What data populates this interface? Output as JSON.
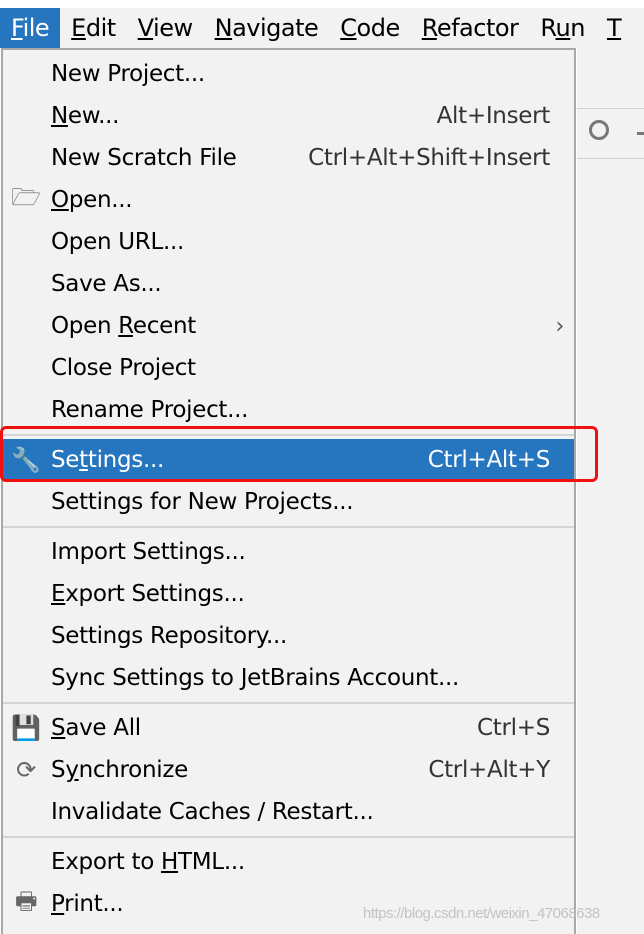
{
  "menubar": [
    {
      "pre": "",
      "m": "F",
      "post": "ile",
      "active": true
    },
    {
      "pre": "",
      "m": "E",
      "post": "dit"
    },
    {
      "pre": "",
      "m": "V",
      "post": "iew"
    },
    {
      "pre": "",
      "m": "N",
      "post": "avigate"
    },
    {
      "pre": "",
      "m": "C",
      "post": "ode"
    },
    {
      "pre": "",
      "m": "R",
      "post": "efactor"
    },
    {
      "pre": "R",
      "m": "u",
      "post": "n"
    },
    {
      "pre": "",
      "m": "T",
      "post": ""
    }
  ],
  "menu": [
    {
      "pre": "New Project...",
      "m": "",
      "post": "",
      "y": 0
    },
    {
      "pre": "",
      "m": "N",
      "post": "ew...",
      "shortcut": "Alt+Insert"
    },
    {
      "pre": "New Scratch File",
      "m": "",
      "post": "",
      "shortcut": "Ctrl+Alt+Shift+Insert"
    },
    {
      "pre": "",
      "m": "O",
      "post": "pen...",
      "icon": "folder-open-icon"
    },
    {
      "pre": "Open URL...",
      "m": "",
      "post": ""
    },
    {
      "pre": "Save As...",
      "m": "",
      "post": ""
    },
    {
      "pre": "Open ",
      "m": "R",
      "post": "ecent",
      "submenu": true
    },
    {
      "pre": "Close Pro",
      "m": "j",
      "post": "ect"
    },
    {
      "pre": "Rename Project...",
      "m": "",
      "post": "",
      "sepAfter": true
    },
    {
      "pre": "Se",
      "m": "t",
      "post": "tings...",
      "shortcut": "Ctrl+Alt+S",
      "icon": "wrench-icon",
      "selected": true
    },
    {
      "pre": "Settings for New Projects...",
      "m": "",
      "post": "",
      "sepAfter": true
    },
    {
      "pre": "Import Settings...",
      "m": "",
      "post": ""
    },
    {
      "pre": "",
      "m": "E",
      "post": "xport Settings..."
    },
    {
      "pre": "Settings Repository...",
      "m": "",
      "post": ""
    },
    {
      "pre": "Sync Settings to JetBrains Account...",
      "m": "",
      "post": "",
      "sepAfter": true
    },
    {
      "pre": "",
      "m": "S",
      "post": "ave All",
      "shortcut": "Ctrl+S",
      "icon": "save-icon"
    },
    {
      "pre": "S",
      "m": "y",
      "post": "nchronize",
      "shortcut": "Ctrl+Alt+Y",
      "icon": "sync-icon"
    },
    {
      "pre": "Invalidate Caches / Restart...",
      "m": "",
      "post": "",
      "sepAfter": true
    },
    {
      "pre": "Export to ",
      "m": "H",
      "post": "TML..."
    },
    {
      "pre": "",
      "m": "P",
      "post": "rint...",
      "icon": "print-icon"
    }
  ],
  "watermark": "https://blog.csdn.net/weixin_47068638",
  "colors": {
    "selection": "#2675bf",
    "highlight_box": "#f01010"
  }
}
